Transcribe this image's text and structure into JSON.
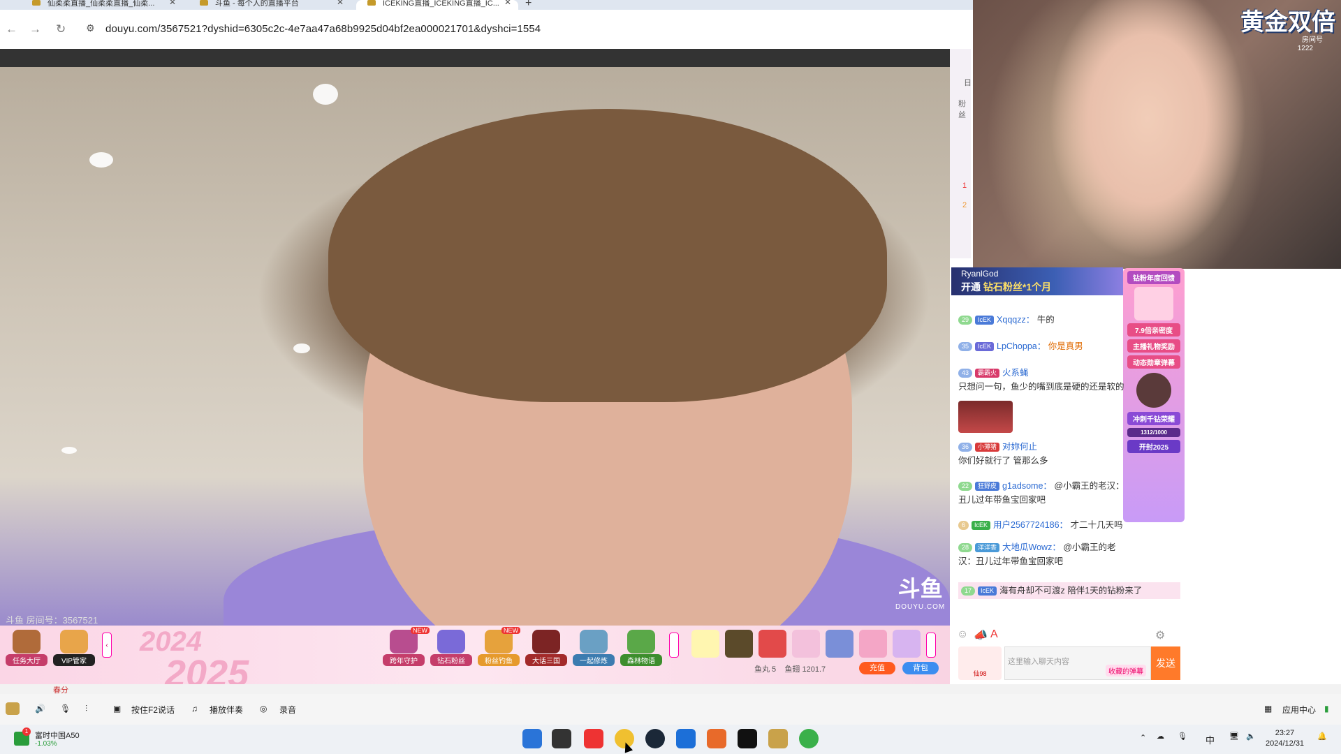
{
  "browser": {
    "tabs": [
      {
        "label": "仙柔柔直播_仙柔柔直播_仙柔..."
      },
      {
        "label": "斗鱼 - 每个人的直播平台"
      },
      {
        "label": "ICEKING直播_ICEKING直播_IC..."
      }
    ],
    "url": "douyu.com/3567521?dyshid=6305c2c-4e7aa47a68b9925d04bf2ea000021701&dyshci=1554"
  },
  "player": {
    "watermark_main": "斗鱼",
    "watermark_sub": "DOUYU.COM",
    "room_label": "斗鱼 房间号：3567521"
  },
  "giftbar": {
    "buttons": [
      {
        "label": "任务大厅"
      },
      {
        "label": "VIP管家"
      },
      {
        "label": "跨年守护"
      },
      {
        "label": "钻石粉丝"
      },
      {
        "label": "粉丝钓鱼"
      },
      {
        "label": "大话三国"
      },
      {
        "label": "一起修炼"
      },
      {
        "label": "森林物语"
      }
    ],
    "new_badge": "NEW",
    "year_top": "2024",
    "year_bottom": "2025",
    "wallet_fishball": "鱼丸 5",
    "wallet_fishwing": "鱼翅 1201.7",
    "recharge_label": "充值",
    "backpack_label": "背包"
  },
  "overlay": {
    "title": "黄金双倍",
    "sub": "房间号",
    "num": "1222"
  },
  "chat": {
    "banner_user": "RyanlGod",
    "banner_text": "开通",
    "banner_highlight": "钻石粉丝*1个月",
    "messages": [
      {
        "level": "29",
        "badge": "IcEK",
        "user": "Xqqqzz：",
        "text": "牛的"
      },
      {
        "level": "35",
        "badge": "IcEK",
        "user": "LpChoppa：",
        "text": "你是真男"
      },
      {
        "level": "43",
        "badge": "霸霸火",
        "user": "火系蝇",
        "text": "只想问一句，鱼少的嘴到底是硬的还是软的"
      },
      {
        "level": "36",
        "badge": "小薄猪",
        "user": "对妳何止",
        "text": "你们好就行了 管那么多"
      },
      {
        "level": "22",
        "badge": "狂野皮",
        "user": "g1adsome：",
        "text": "@小霸王的老汉：丑儿过年带鱼宝回家吧"
      },
      {
        "level": "6",
        "badge": "IcEK",
        "user": "用户2567724186：",
        "text": "才二十几天吗"
      },
      {
        "level": "28",
        "badge": "洋洋香",
        "user": "大地瓜Wowz：",
        "text": "@小霸王的老汉：丑儿过年带鱼宝回家吧"
      },
      {
        "level": "17",
        "badge": "IcEK",
        "user": "",
        "text": "海有舟却不可渡z 陪伴1天的钻粉来了"
      }
    ],
    "placeholder": "这里输入聊天内容",
    "barrage": "收藏的弹幕",
    "send": "发送",
    "fan_level": "仙98"
  },
  "promo": {
    "line1": "钻粉年度回馈",
    "line2": "7.9倍亲密度",
    "line3": "主播礼物奖励",
    "line4": "动态勋章弹幕",
    "line5": "冲刺千钻荣耀",
    "line6": "1312/1000",
    "line7": "开封2025"
  },
  "side": {
    "day": "日",
    "fans": "粉丝",
    "rank1": "1",
    "rank2": "2"
  },
  "strip": {
    "text": "春分"
  },
  "toolbar": {
    "push_to_talk": "按住F2说话",
    "accompaniment": "播放伴奏",
    "record": "录音",
    "app_center": "应用中心"
  },
  "taskbar": {
    "stock_name": "富时中国A50",
    "stock_change": "-1.03%",
    "time": "23:27",
    "date": "2024/12/31",
    "ime": "中"
  }
}
